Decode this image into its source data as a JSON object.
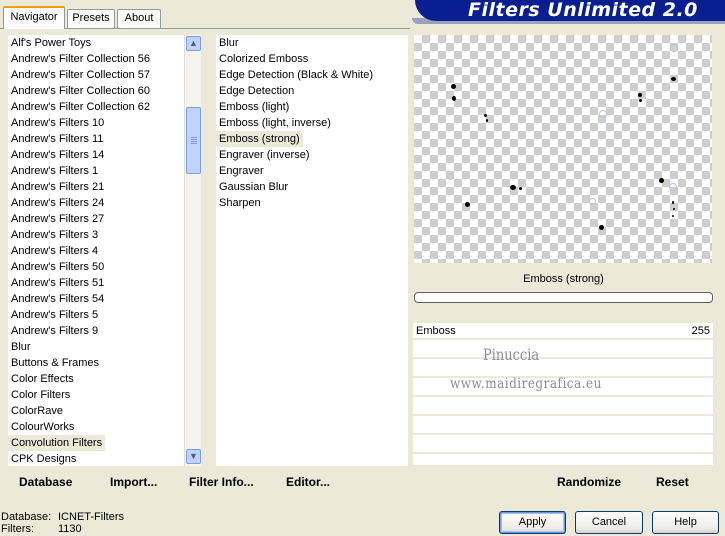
{
  "tabs": [
    {
      "label": "Navigator",
      "active": true
    },
    {
      "label": "Presets",
      "active": false
    },
    {
      "label": "About",
      "active": false
    }
  ],
  "banner": {
    "title": "Filters Unlimited 2.0"
  },
  "categories": {
    "items": [
      "Alf's Power Toys",
      "Andrew's Filter Collection 56",
      "Andrew's Filter Collection 57",
      "Andrew's Filter Collection 60",
      "Andrew's Filter Collection 62",
      "Andrew's Filters 10",
      "Andrew's Filters 11",
      "Andrew's Filters 14",
      "Andrew's Filters 1",
      "Andrew's Filters 21",
      "Andrew's Filters 24",
      "Andrew's Filters 27",
      "Andrew's Filters 3",
      "Andrew's Filters 4",
      "Andrew's Filters 50",
      "Andrew's Filters 51",
      "Andrew's Filters 54",
      "Andrew's Filters 5",
      "Andrew's Filters 9",
      "Blur",
      "Buttons & Frames",
      "Color Effects",
      "Color Filters",
      "ColorRave",
      "ColourWorks",
      "Convolution Filters",
      "CPK Designs"
    ],
    "selected": "Convolution Filters"
  },
  "filters": {
    "items": [
      "Blur",
      "Colorized Emboss",
      "Edge Detection (Black & White)",
      "Edge Detection",
      "Emboss (light)",
      "Emboss (light, inverse)",
      "Emboss (strong)",
      "Engraver (inverse)",
      "Engraver",
      "Gaussian Blur",
      "Sharpen"
    ],
    "selected": "Emboss (strong)"
  },
  "preview": {
    "filter_name": "Emboss (strong)"
  },
  "params": [
    {
      "label": "Emboss",
      "value": "255"
    }
  ],
  "watermark": {
    "line1": "Pinuccia",
    "line2": "www.maidiregrafica.eu"
  },
  "bottom_links": {
    "database": "Database",
    "import": "Import...",
    "filter_info": "Filter Info...",
    "editor": "Editor...",
    "randomize": "Randomize",
    "reset": "Reset"
  },
  "status": {
    "database_label": "Database:",
    "database_value": "ICNET-Filters",
    "filters_label": "Filters:",
    "filters_value": "1130"
  },
  "buttons": {
    "apply": "Apply",
    "cancel": "Cancel",
    "help": "Help"
  },
  "colors": {
    "banner": "#0a1f8f",
    "face": "#ece9d8",
    "selection": "#ece9d8",
    "scroll": "#c1d3fb"
  }
}
